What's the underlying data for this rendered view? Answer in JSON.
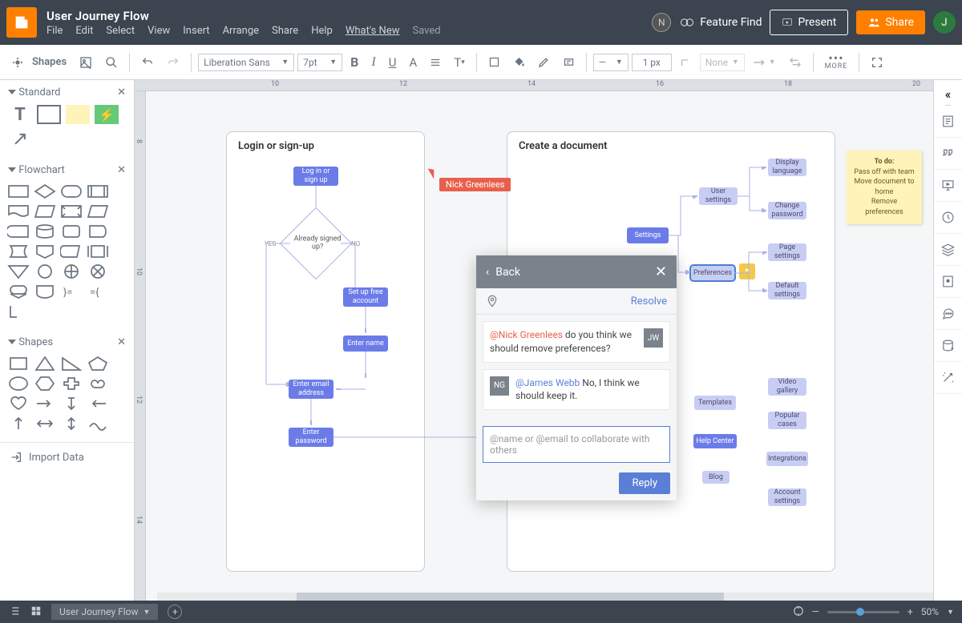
{
  "header": {
    "title": "User Journey Flow",
    "menus": [
      "File",
      "Edit",
      "Select",
      "View",
      "Insert",
      "Arrange",
      "Share",
      "Help",
      "What's New"
    ],
    "saved": "Saved",
    "featureFind": "Feature Find",
    "present": "Present",
    "share": "Share",
    "avatar": "J",
    "n_badge": "N"
  },
  "toolbar": {
    "shapes": "Shapes",
    "font": "Liberation Sans",
    "fontSize": "7pt",
    "strokeWidth": "1 px",
    "lineStyle": "None",
    "more": "MORE"
  },
  "left": {
    "sections": {
      "standard": "Standard",
      "flowchart": "Flowchart",
      "shapes": "Shapes"
    },
    "import": "Import Data"
  },
  "ruler": {
    "h": [
      "10",
      "12",
      "14",
      "16",
      "18",
      "20"
    ],
    "v": [
      "8",
      "10",
      "12",
      "14"
    ]
  },
  "frames": {
    "login": {
      "title": "Login or sign-up",
      "nodes": {
        "login": "Log in or\nsign up",
        "already": "Already\nsigned up?",
        "yes": "YES",
        "no": "NO",
        "setup": "Set up free\naccount",
        "name": "Enter name",
        "email": "Enter email\naddress",
        "password": "Enter\npassword"
      }
    },
    "create": {
      "title": "Create a document",
      "nodes": {
        "settings": "Settings",
        "userSettings": "User\nsettings",
        "preferences": "Preferences",
        "display": "Display\nlanguage",
        "changepw": "Change\npassword",
        "pageSettings": "Page\nsettings",
        "defaultSettings": "Default\nsettings",
        "video": "Video\ngallery",
        "popular": "Popular\ncases",
        "integrations": "Integrations",
        "account": "Account\nsettings",
        "templates": "Templates",
        "help": "Help Center",
        "blog": "Blog"
      }
    }
  },
  "sticky": {
    "lines": [
      "To do:",
      "Pass off with team",
      "Move document to home",
      "Remove preferences"
    ]
  },
  "cursor": {
    "name": "Nick Greenlees"
  },
  "comments": {
    "back": "Back",
    "resolve": "Resolve",
    "thread": [
      {
        "avatar": "JW",
        "mention": "@Nick Greenlees",
        "mentionColor": "red",
        "rest": " do you think we should remove preferences?"
      },
      {
        "avatar": "NG",
        "mention": "@James Webb",
        "mentionColor": "blue",
        "rest": " No, I think we should keep it."
      }
    ],
    "placeholder": "@name or @email to collaborate with others",
    "reply": "Reply"
  },
  "bottom": {
    "tab": "User Journey Flow",
    "zoom": "50%"
  }
}
